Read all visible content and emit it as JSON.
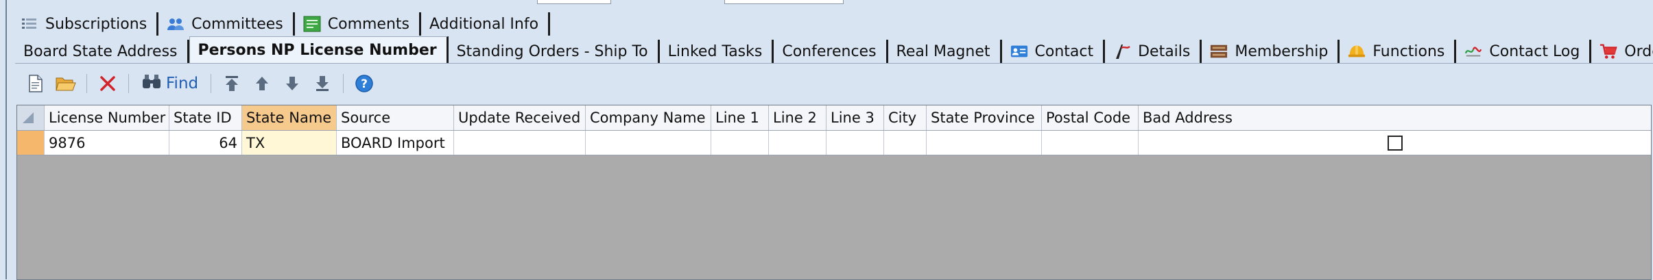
{
  "tabs_row1": [
    {
      "label": "Subscriptions",
      "icon": "list-icon"
    },
    {
      "label": "Committees",
      "icon": "people-icon"
    },
    {
      "label": "Comments",
      "icon": "comment-icon"
    },
    {
      "label": "Additional Info",
      "icon": ""
    }
  ],
  "tabs_row2": [
    {
      "label": "Board State Address",
      "active": false
    },
    {
      "label": "Persons NP License Number",
      "active": true
    },
    {
      "label": "Standing Orders - Ship To",
      "active": false
    },
    {
      "label": "Linked Tasks",
      "active": false
    },
    {
      "label": "Conferences",
      "active": false
    },
    {
      "label": "Real Magnet",
      "active": false
    },
    {
      "label": "Contact",
      "icon": "contact-card-icon"
    },
    {
      "label": "Details",
      "icon": "details-pen-icon"
    },
    {
      "label": "Membership",
      "icon": "membership-icon"
    },
    {
      "label": "Functions",
      "icon": "hardhat-icon"
    },
    {
      "label": "Contact Log",
      "icon": "contact-log-icon"
    },
    {
      "label": "Orders",
      "icon": "cart-icon"
    }
  ],
  "toolbar": {
    "find_label": "Find",
    "buttons": [
      "new-document-icon",
      "open-folder-icon",
      "delete-icon",
      "find-binoculars-icon",
      "move-top-icon",
      "move-up-icon",
      "move-down-icon",
      "move-bottom-icon",
      "help-icon"
    ]
  },
  "grid": {
    "columns": [
      "License Number",
      "State ID",
      "State Name",
      "Source",
      "Update Received",
      "Company Name",
      "Line 1",
      "Line 2",
      "Line 3",
      "City",
      "State Province",
      "Postal Code",
      "Bad Address"
    ],
    "highlighted_column": "State Name",
    "rows": [
      {
        "License Number": "9876",
        "State ID": "64",
        "State Name": "TX",
        "Source": "BOARD Import",
        "Update Received": "",
        "Company Name": "",
        "Line 1": "",
        "Line 2": "",
        "Line 3": "",
        "City": "",
        "State Province": "",
        "Postal Code": "",
        "Bad Address": false
      }
    ]
  },
  "colors": {
    "background": "#d9e4f2",
    "grid_empty": "#ababab",
    "selected_header": "#f6c98d",
    "row_indicator": "#f4b76b"
  }
}
